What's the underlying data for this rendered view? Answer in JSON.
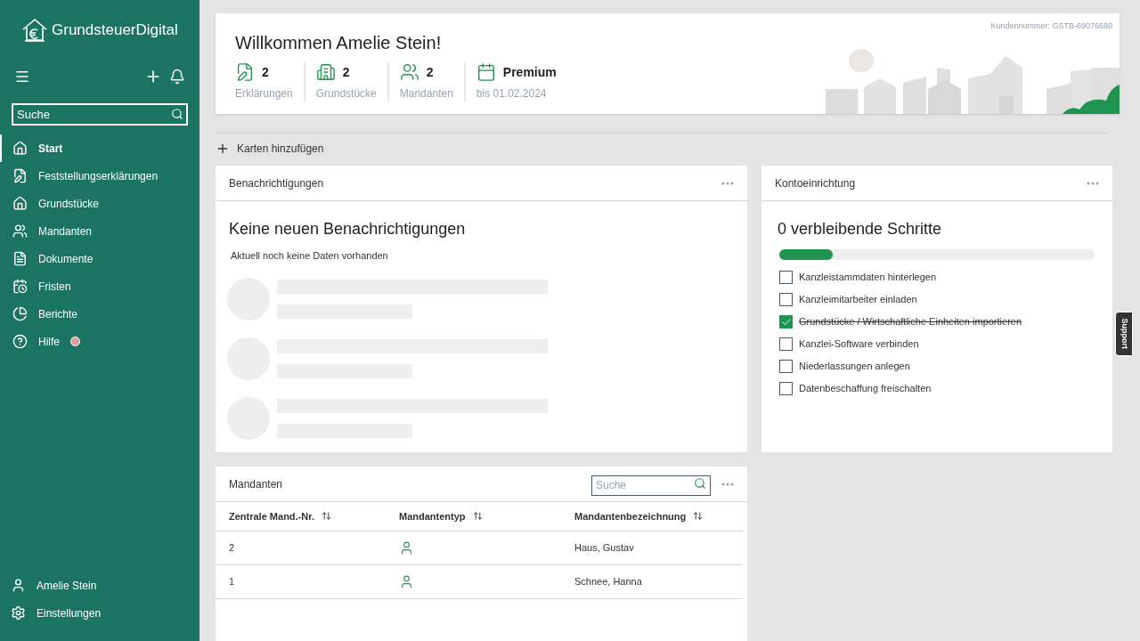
{
  "sidebar": {
    "logo": "GrundsteuerDigital",
    "search": {
      "placeholder": "Suche"
    },
    "items": [
      {
        "label": "Start",
        "selected": true
      },
      {
        "label": "Feststellungserklärungen",
        "selected": false
      },
      {
        "label": "Grundstücke",
        "selected": false
      },
      {
        "label": "Mandanten",
        "selected": false
      },
      {
        "label": "Dokumente",
        "selected": false
      },
      {
        "label": "Fristen",
        "selected": false
      },
      {
        "label": "Berichte",
        "selected": false
      },
      {
        "label": "Hilfe",
        "selected": false
      }
    ],
    "bottom_items": [
      {
        "label": "Amelie Stein"
      },
      {
        "label": "Einstellungen"
      }
    ]
  },
  "header": {
    "title": "Willkommen Amelie Stein!",
    "customer_number": "Kundennummer: GSTB-69076680",
    "stats": [
      {
        "value": "2",
        "label": "Erklärungen"
      },
      {
        "value": "2",
        "label": "Grundstücke"
      },
      {
        "value": "2",
        "label": "Mandanten"
      },
      {
        "value": "Premium",
        "label": "bis 01.02.2024"
      }
    ]
  },
  "add_cards": "Karten hinzufügen",
  "notifications": {
    "title": "Benachrichtigungen",
    "heading": "Keine neuen Benachrichtigungen",
    "text": "Aktuell noch keine Daten vorhanden"
  },
  "setup": {
    "title": "Kontoeinrichtung",
    "heading": "0 verbleibende Schritte",
    "level": 0.17,
    "steps": [
      {
        "label": "Kanzleistammdaten hinterlegen",
        "checked": false
      },
      {
        "label": "Kanzleimitarbeiter einladen",
        "checked": false
      },
      {
        "label": "Grundstücke / Wirtschaftliche Einheiten importieren",
        "checked": true
      },
      {
        "label": "Kanzlei-Software verbinden",
        "checked": false
      },
      {
        "label": "Niederlassungen anlegen",
        "checked": false
      },
      {
        "label": "Datenbeschaffung freischalten",
        "checked": false
      }
    ]
  },
  "clients": {
    "title": "Mandanten",
    "search": {
      "placeholder": "Suche"
    },
    "columns": [
      "Zentrale Mand.-Nr.",
      "Mandantentyp",
      "Mandantenbezeichnung"
    ],
    "rows": [
      {
        "number": "2",
        "kind": "person",
        "name": "Haus, Gustav"
      },
      {
        "number": "1",
        "kind": "person",
        "name": "Schnee, Hanna"
      }
    ]
  },
  "support": "Support"
}
